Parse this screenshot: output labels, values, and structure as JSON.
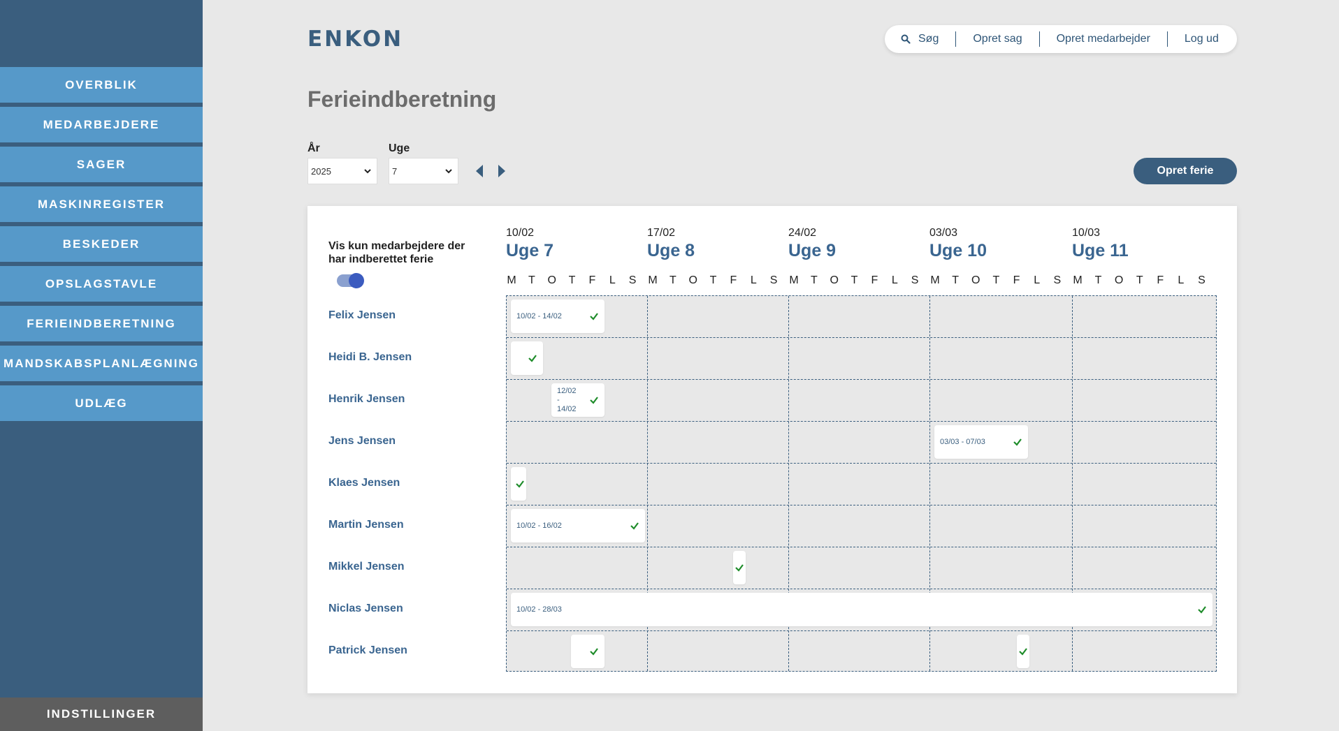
{
  "sidebar": {
    "items": [
      {
        "label": "OVERBLIK"
      },
      {
        "label": "MEDARBEJDERE"
      },
      {
        "label": "SAGER"
      },
      {
        "label": "MASKINREGISTER"
      },
      {
        "label": "BESKEDER"
      },
      {
        "label": "OPSLAGSTAVLE"
      },
      {
        "label": "FERIEINDBERETNING"
      },
      {
        "label": "MANDSKABSPLANLÆGNING"
      },
      {
        "label": "UDLÆG"
      }
    ],
    "settings_label": "INDSTILLINGER"
  },
  "header": {
    "logo": "ENKON",
    "nav": {
      "search": "Søg",
      "create_case": "Opret sag",
      "create_employee": "Opret medarbejder",
      "logout": "Log ud"
    }
  },
  "page": {
    "title": "Ferieindberetning",
    "year_label": "År",
    "year_value": "2025",
    "week_label": "Uge",
    "week_value": "7",
    "create_button": "Opret ferie"
  },
  "calendar": {
    "filter_label": "Vis kun medarbejdere der har indberettet ferie",
    "filter_on": true,
    "weeks": [
      {
        "date": "10/02",
        "name": "Uge 7"
      },
      {
        "date": "17/02",
        "name": "Uge 8"
      },
      {
        "date": "24/02",
        "name": "Uge 9"
      },
      {
        "date": "03/03",
        "name": "Uge 10"
      },
      {
        "date": "10/03",
        "name": "Uge 11"
      }
    ],
    "day_letters": [
      "M",
      "T",
      "O",
      "T",
      "F",
      "L",
      "S"
    ],
    "employees": [
      {
        "name": "Felix Jensen"
      },
      {
        "name": "Heidi B. Jensen"
      },
      {
        "name": "Henrik Jensen"
      },
      {
        "name": "Jens Jensen"
      },
      {
        "name": "Klaes Jensen"
      },
      {
        "name": "Martin Jensen"
      },
      {
        "name": "Mikkel Jensen"
      },
      {
        "name": "Niclas Jensen"
      },
      {
        "name": "Patrick Jensen"
      }
    ],
    "vacations": [
      {
        "row": 0,
        "label": "10/02 - 14/02",
        "approved": true
      },
      {
        "row": 1,
        "label": "",
        "approved": true
      },
      {
        "row": 2,
        "label": "12/02 - 14/02",
        "approved": true
      },
      {
        "row": 3,
        "label": "03/03 - 07/03",
        "approved": true
      },
      {
        "row": 4,
        "label": "",
        "approved": true
      },
      {
        "row": 5,
        "label": "10/02 - 16/02",
        "approved": true
      },
      {
        "row": 6,
        "label": "",
        "approved": true
      },
      {
        "row": 7,
        "label": "10/02 - 28/03",
        "approved": true
      },
      {
        "row": 8,
        "label": "",
        "approved": true
      },
      {
        "row": 8,
        "label": "",
        "approved": true
      }
    ],
    "colors": {
      "approved_check": "#1e8c2a",
      "accent": "#3a5e7e"
    }
  }
}
